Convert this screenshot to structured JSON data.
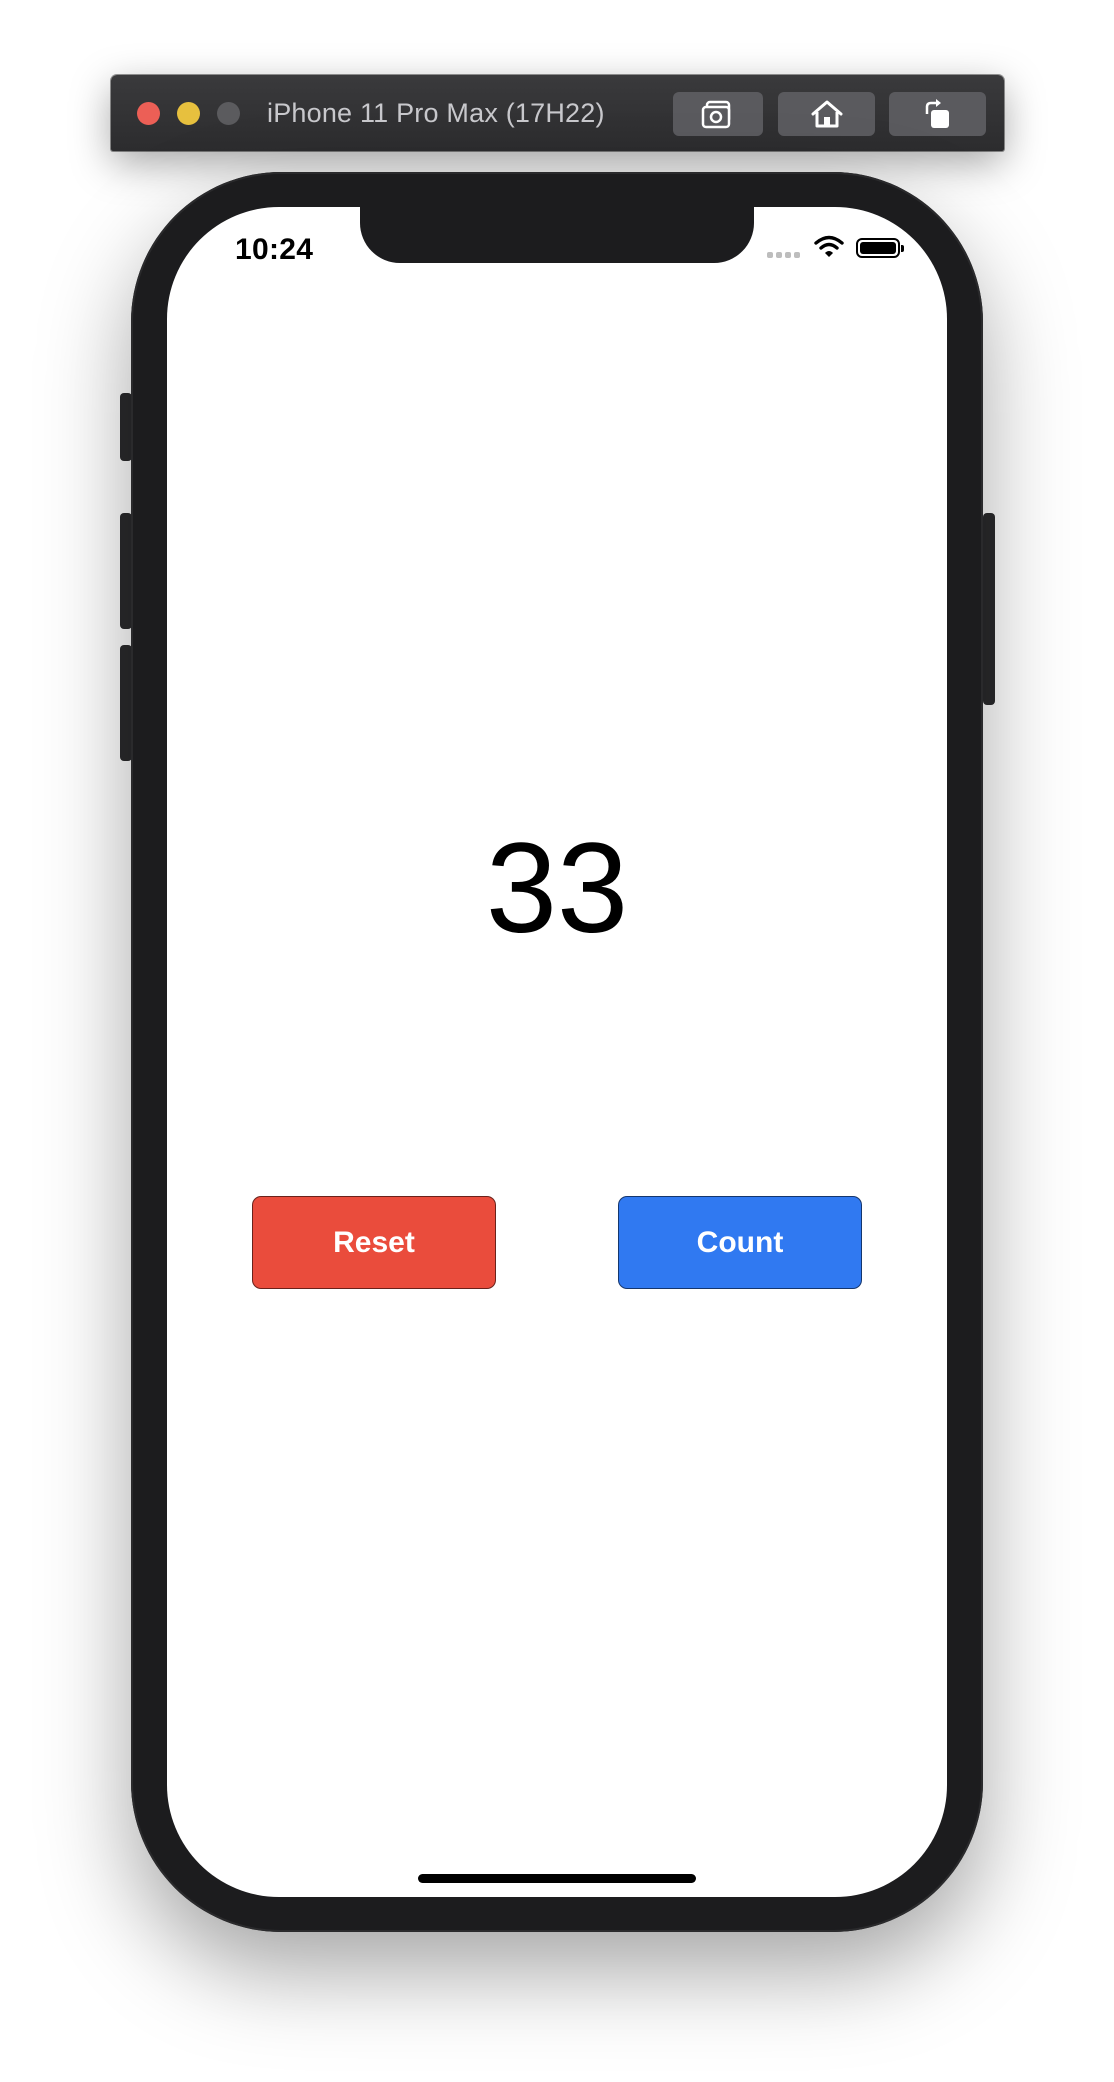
{
  "window": {
    "title": "iPhone 11 Pro Max (17H22)",
    "toolbar": {
      "screenshot_icon": "camera-icon",
      "home_icon": "home-icon",
      "rotate_icon": "rotate-icon"
    },
    "traffic_lights": {
      "close_color": "#ec5f56",
      "minimize_color": "#e7c03e",
      "zoom_color": "#5b5b5e"
    }
  },
  "status_bar": {
    "time": "10:24",
    "icons": [
      "cellular-signal-icon",
      "wifi-icon",
      "battery-icon"
    ],
    "battery_level": 1.0
  },
  "app": {
    "counter_value": "33",
    "reset_label": "Reset",
    "count_label": "Count",
    "reset_color": "#ea4c3c",
    "count_color": "#3079f1"
  }
}
